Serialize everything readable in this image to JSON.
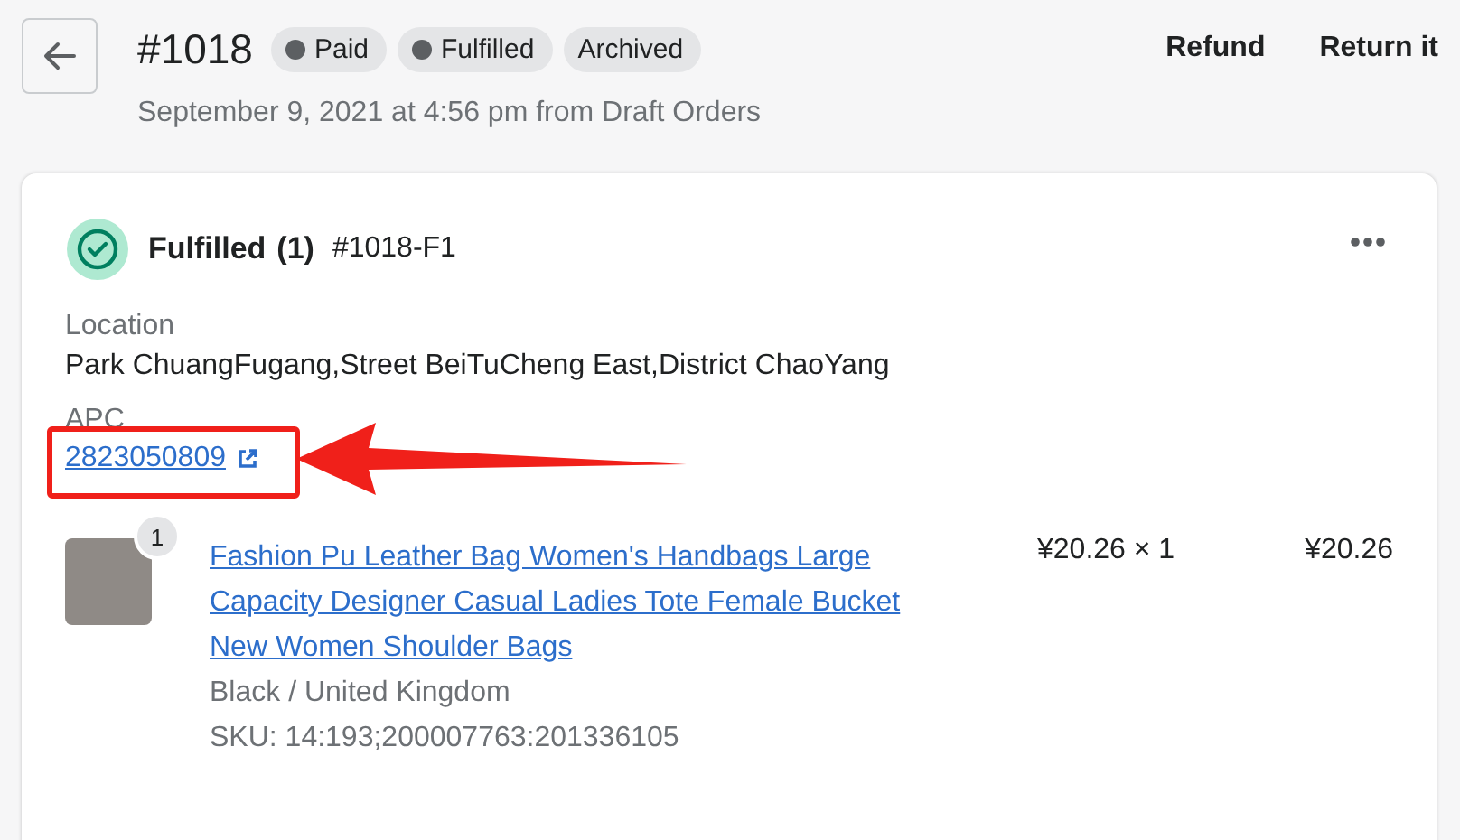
{
  "header": {
    "order_number": "#1018",
    "badges": [
      {
        "label": "Paid",
        "dot": true
      },
      {
        "label": "Fulfilled",
        "dot": true
      },
      {
        "label": "Archived",
        "dot": false
      }
    ],
    "actions": [
      "Refund",
      "Return it"
    ],
    "subtitle": "September 9, 2021 at 4:56 pm from Draft Orders"
  },
  "fulfillment": {
    "title": "Fulfilled",
    "count": "(1)",
    "number": "#1018-F1",
    "location_label": "Location",
    "location": "Park ChuangFugang,Street BeiTuCheng East,District ChaoYang",
    "tracking_label": "APC",
    "tracking_number": "2823050809",
    "items": [
      {
        "quantity": "1",
        "name": "Fashion Pu Leather Bag Women's Handbags Large Capacity Designer Casual Ladies Tote Female Bucket New Women Shoulder Bags",
        "variant": "Black / United Kingdom",
        "sku": "SKU: 14:193;200007763:201336105",
        "price": "¥20.26 × 1",
        "total": "¥20.26"
      }
    ]
  }
}
